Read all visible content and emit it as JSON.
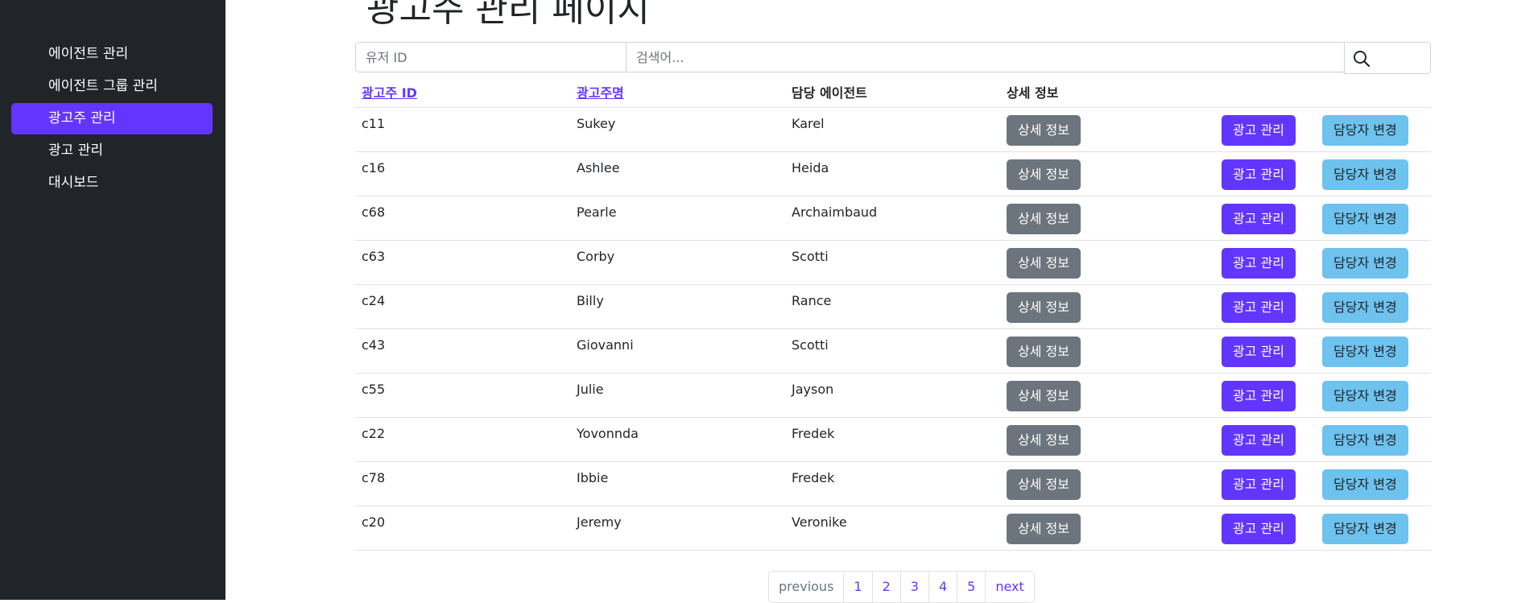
{
  "sidebar": {
    "items": [
      {
        "label": "에이전트 관리"
      },
      {
        "label": "에이전트 그룹 관리"
      },
      {
        "label": "광고주 관리"
      },
      {
        "label": "광고 관리"
      },
      {
        "label": "대시보드"
      }
    ],
    "active_index": 2
  },
  "page": {
    "title": "광고주 관리 페이지"
  },
  "search": {
    "user_placeholder": "유저 ID",
    "keyword_placeholder": "검색어...",
    "icon": "search-icon"
  },
  "table": {
    "headers": [
      "광고주 ID",
      "광고주명",
      "담당 에이전트",
      "상세 정보"
    ],
    "button_labels": {
      "detail": "상세 정보",
      "ad": "광고 관리",
      "owner": "담당자 변경"
    },
    "rows": [
      {
        "id": "c11",
        "name": "Sukey",
        "agent": "Karel"
      },
      {
        "id": "c16",
        "name": "Ashlee",
        "agent": "Heida"
      },
      {
        "id": "c68",
        "name": "Pearle",
        "agent": "Archaimbaud"
      },
      {
        "id": "c63",
        "name": "Corby",
        "agent": "Scotti"
      },
      {
        "id": "c24",
        "name": "Billy",
        "agent": "Rance"
      },
      {
        "id": "c43",
        "name": "Giovanni",
        "agent": "Scotti"
      },
      {
        "id": "c55",
        "name": "Julie",
        "agent": "Jayson"
      },
      {
        "id": "c22",
        "name": "Yovonnda",
        "agent": "Fredek"
      },
      {
        "id": "c78",
        "name": "Ibbie",
        "agent": "Fredek"
      },
      {
        "id": "c20",
        "name": "Jeremy",
        "agent": "Veronike"
      }
    ]
  },
  "pagination": {
    "previous": "previous",
    "pages": [
      "1",
      "2",
      "3",
      "4",
      "5"
    ],
    "next": "next"
  },
  "colors": {
    "sidebar_bg": "#212529",
    "accent": "#6236ff",
    "detail_button": "#6c757d",
    "owner_button": "#6ec2ee"
  }
}
